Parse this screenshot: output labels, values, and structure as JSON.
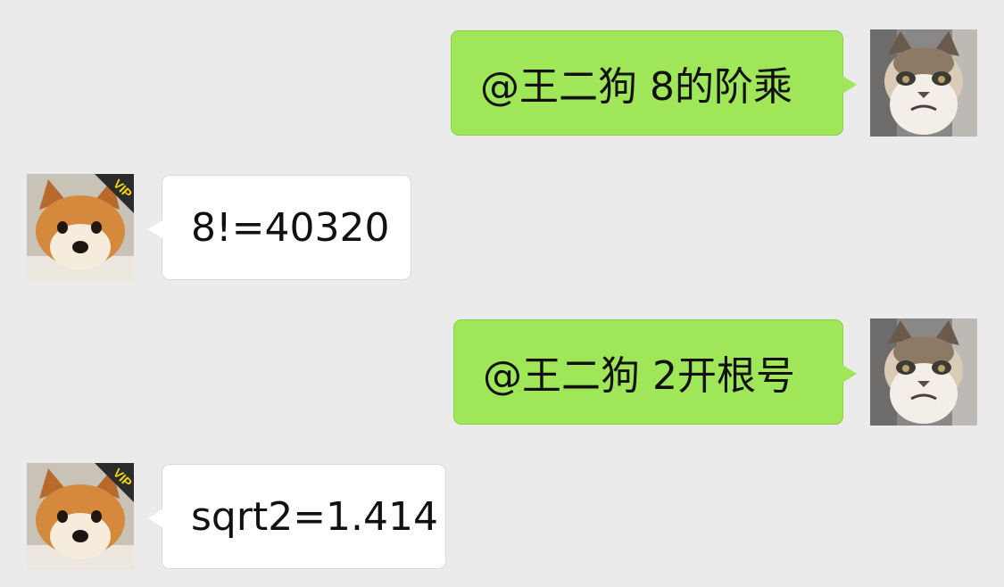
{
  "chat": {
    "messages": [
      {
        "sender": "self",
        "text": "@王二狗 8的阶乘",
        "avatar": "grumpy-cat-avatar"
      },
      {
        "sender": "bot",
        "text": "8!=40320",
        "avatar": "shiba-dog-avatar",
        "badge": "VIP"
      },
      {
        "sender": "self",
        "text": "@王二狗 2开根号",
        "avatar": "grumpy-cat-avatar"
      },
      {
        "sender": "bot",
        "text": "sqrt2=1.414",
        "avatar": "shiba-dog-avatar",
        "badge": "VIP"
      }
    ]
  },
  "colors": {
    "background": "#ebebeb",
    "outgoing_bubble": "#9fe658",
    "incoming_bubble": "#ffffff",
    "vip_badge_bg": "#2b2b2b",
    "vip_badge_text": "#f5d90a"
  }
}
